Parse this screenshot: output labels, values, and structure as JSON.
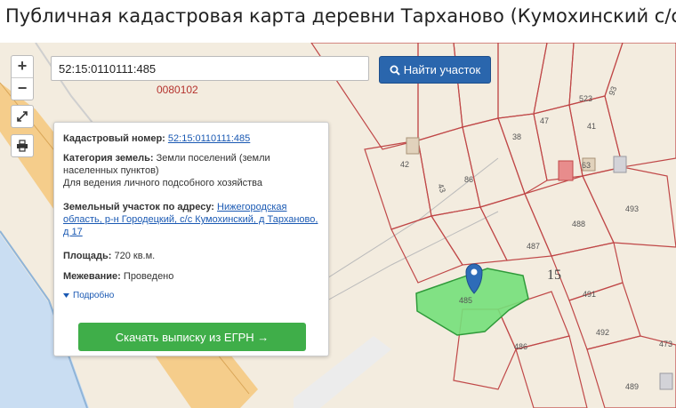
{
  "page": {
    "title": "Публичная кадастровая карта деревни Тарханово (Кумохинский с/с)"
  },
  "search": {
    "value": "52:15:0110111:485",
    "button_label": "Найти участок"
  },
  "map": {
    "quarter_code": "0080102",
    "quarter_number": "15",
    "zoom_in": "+",
    "zoom_out": "−",
    "parcel_labels": {
      "p523": "523",
      "p93": "93",
      "p47": "47",
      "p41": "41",
      "p38": "38",
      "p42": "42",
      "p63": "63",
      "p86": "86",
      "p43": "43",
      "p493": "493",
      "p488": "488",
      "p487": "487",
      "p485": "485",
      "p491": "491",
      "p492": "492",
      "p486": "486",
      "p473": "473",
      "p489": "489"
    }
  },
  "info": {
    "cadastral_label": "Кадастровый номер:",
    "cadastral_value": "52:15:0110111:485",
    "category_label": "Категория земель:",
    "category_value_1": "Земли поселений (земли",
    "category_value_2": "населенных пунктов)",
    "category_value_3": "Для ведения личного подсобного хозяйства",
    "address_label": "Земельный участок по адресу:",
    "address_value_1": "Нижегородская",
    "address_value_2": "область, р-н Городецкий, с/с Кумохинский, д Тарханово,",
    "address_value_3": "д 17",
    "area_label": "Площадь:",
    "area_value": "720 кв.м.",
    "survey_label": "Межевание:",
    "survey_value": "Проведено",
    "more_label": "Подробно",
    "download_label": "Скачать выписку из ЕГРН →"
  },
  "colors": {
    "selected_parcel": "#74e07a",
    "parcel_border": "#c04848",
    "water": "#c9ddf2",
    "road": "#f4c87d",
    "button_blue": "#2a66ad",
    "button_green": "#3fae49"
  }
}
